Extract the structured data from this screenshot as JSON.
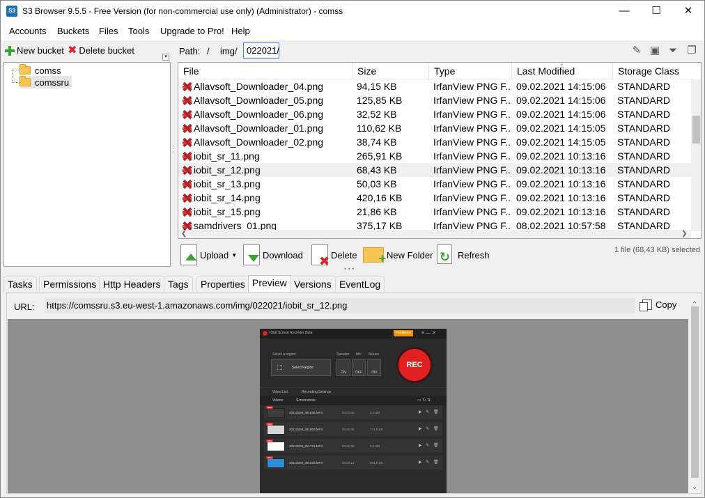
{
  "window": {
    "title": "S3 Browser 9.5.5 - Free Version (for non-commercial use only) (Administrator) - comss",
    "icon_label": "S3",
    "minimize_glyph": "—",
    "maximize_glyph": "☐",
    "close_glyph": "✕"
  },
  "menu": {
    "items": [
      "Accounts",
      "Buckets",
      "Files",
      "Tools",
      "Upgrade to Pro!",
      "Help"
    ]
  },
  "bucket_toolbar": {
    "new_bucket": "New bucket",
    "delete_bucket": "Delete bucket"
  },
  "buckets": [
    {
      "name": "comss",
      "selected": false
    },
    {
      "name": "comssru",
      "selected": true
    }
  ],
  "path_bar": {
    "label": "Path:",
    "sep": "/",
    "segments": [
      "img/"
    ],
    "current": "022021/"
  },
  "file_table": {
    "columns": [
      "File",
      "Size",
      "Type",
      "Last Modified",
      "Storage Class"
    ],
    "rows": [
      {
        "file": "Allavsoft_Downloader_04.png",
        "size": "94,15 KB",
        "type": "IrfanView PNG F...",
        "modified": "09.02.2021 14:15:06",
        "storage": "STANDARD",
        "selected": false
      },
      {
        "file": "Allavsoft_Downloader_05.png",
        "size": "125,85 KB",
        "type": "IrfanView PNG F...",
        "modified": "09.02.2021 14:15:06",
        "storage": "STANDARD",
        "selected": false
      },
      {
        "file": "Allavsoft_Downloader_06.png",
        "size": "32,52 KB",
        "type": "IrfanView PNG F...",
        "modified": "09.02.2021 14:15:06",
        "storage": "STANDARD",
        "selected": false
      },
      {
        "file": "Allavsoft_Downloader_01.png",
        "size": "110,62 KB",
        "type": "IrfanView PNG F...",
        "modified": "09.02.2021 14:15:05",
        "storage": "STANDARD",
        "selected": false
      },
      {
        "file": "Allavsoft_Downloader_02.png",
        "size": "38,74 KB",
        "type": "IrfanView PNG F...",
        "modified": "09.02.2021 14:15:05",
        "storage": "STANDARD",
        "selected": false
      },
      {
        "file": "iobit_sr_11.png",
        "size": "265,91 KB",
        "type": "IrfanView PNG F...",
        "modified": "09.02.2021 10:13:16",
        "storage": "STANDARD",
        "selected": false
      },
      {
        "file": "iobit_sr_12.png",
        "size": "68,43 KB",
        "type": "IrfanView PNG F...",
        "modified": "09.02.2021 10:13:16",
        "storage": "STANDARD",
        "selected": true
      },
      {
        "file": "iobit_sr_13.png",
        "size": "50,03 KB",
        "type": "IrfanView PNG F...",
        "modified": "09.02.2021 10:13:16",
        "storage": "STANDARD",
        "selected": false
      },
      {
        "file": "iobit_sr_14.png",
        "size": "420,16 KB",
        "type": "IrfanView PNG F...",
        "modified": "09.02.2021 10:13:16",
        "storage": "STANDARD",
        "selected": false
      },
      {
        "file": "iobit_sr_15.png",
        "size": "21,86 KB",
        "type": "IrfanView PNG F...",
        "modified": "09.02.2021 10:13:16",
        "storage": "STANDARD",
        "selected": false
      },
      {
        "file": "samdrivers_01.png",
        "size": "375,17 KB",
        "type": "IrfanView PNG F...",
        "modified": "08.02.2021 10:57:58",
        "storage": "STANDARD",
        "selected": false
      }
    ]
  },
  "actions": {
    "upload": "Upload",
    "download": "Download",
    "delete": "Delete",
    "new_folder": "New Folder",
    "refresh": "Refresh",
    "selection_status": "1 file (68,43 KB) selected"
  },
  "tabs": [
    {
      "label": "Tasks",
      "active": false
    },
    {
      "label": "Permissions",
      "active": false
    },
    {
      "label": "Http Headers",
      "active": false
    },
    {
      "label": "Tags",
      "active": false
    },
    {
      "label": "Properties",
      "active": false
    },
    {
      "label": "Preview",
      "active": true
    },
    {
      "label": "Versions",
      "active": false
    },
    {
      "label": "EventLog",
      "active": false
    }
  ],
  "preview": {
    "url_label": "URL:",
    "url": "https://comssru.s3.eu-west-1.amazonaws.com/img/022021/iobit_sr_12.png",
    "copy_label": "Copy",
    "image": {
      "app_title": "IObit Screen Recorder Beta",
      "feedback": "Feedback",
      "select_region_label": "Select a region:",
      "select_region_value": "Select Region",
      "speaker": "Speaker",
      "mic": "Mic",
      "mouse": "Mouse",
      "speaker_state": "ON",
      "mic_state": "OFF",
      "mouse_state": "ON",
      "rec": "REC",
      "nav_video_list": "Video List",
      "nav_recording_settings": "Recording Settings",
      "tab_videos": "Videos",
      "tab_screenshots": "Screenshots",
      "new_badge": "NEW",
      "recordings": [
        {
          "name": "20210209_091836.MP4",
          "duration": "00:01:55",
          "size": "2,0 MB"
        },
        {
          "name": "20210209_091800.MP4",
          "duration": "00:00:05",
          "size": "174,0 KB"
        },
        {
          "name": "20210209_091721.MP4",
          "duration": "00:00:09",
          "size": "3,3 MB"
        },
        {
          "name": "20210209_091630.MP4",
          "duration": "00:00:12",
          "size": "393,9 KB"
        }
      ]
    }
  },
  "colors": {
    "accent": "#3a7bd5",
    "rec_red": "#e02020",
    "feedback_orange": "#f29100",
    "green_icon": "#3aa335"
  }
}
